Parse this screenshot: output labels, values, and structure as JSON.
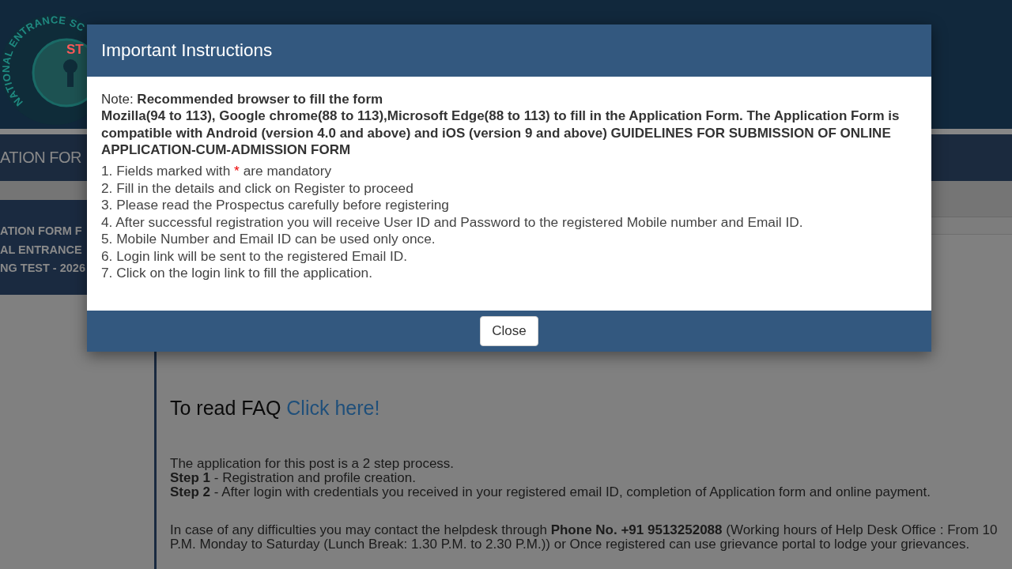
{
  "header": {
    "logo": {
      "ring_text": "NATIONAL ENTRANCE SC",
      "inner_text": "ST"
    }
  },
  "nav_bar": {
    "title": "ATION FOR"
  },
  "sidebar": {
    "lines": [
      "ATION FORM F",
      "AL ENTRANCE",
      "NG TEST - 2026"
    ]
  },
  "content": {
    "guide_lines": [
      {
        "text": "To read FAQ",
        "link": "Click here!"
      }
    ],
    "process_lines": [
      "The application for this post is a 2 step process.",
      "**Step 1** - Registration and profile creation.",
      "**Step 2** - After login with credentials you received in your registered email ID, completion of Application form and online payment."
    ],
    "helpdesk_lines": [
      "In case of any difficulties you may contact the helpdesk through **Phone No. +91 9513252088** (Working hours of Help Desk Office : From 10",
      "P.M. Monday to Saturday (Lunch Break: 1.30 P.M. to 2.30 P.M.)) or Once registered can use grievance portal to lodge your grievances."
    ]
  },
  "modal": {
    "title": "Important Instructions",
    "note_heading": "Note: **Recommended browser to fill the form**",
    "browser_note": "Mozilla(94 to 113), Google chrome(88 to 113),Microsoft Edge(88 to 113) to fill in the Application Form. The Application Form is compatible with Android (version 4.0 and above) and iOS (version 9 and above) GUIDELINES FOR SUBMISSION OF ONLINE APPLICATION-CUM-ADMISSION FORM",
    "items": [
      {
        "text": "1. Fields marked with",
        "required_mark": "*",
        "text_after": "are mandatory"
      },
      {
        "text": "2. Fill in the details and click on Register to proceed"
      },
      {
        "text": "3. Please read the Prospectus carefully before registering"
      },
      {
        "text": "4. After successful registration you will receive User ID and Password to the registered Mobile number and Email ID."
      },
      {
        "text": "5. Mobile Number and Email ID can be used only once."
      },
      {
        "text": "6. Login link will be sent to the registered Email ID."
      },
      {
        "text": "7. Click on the login link to fill the application."
      }
    ],
    "close_button": "Close"
  }
}
